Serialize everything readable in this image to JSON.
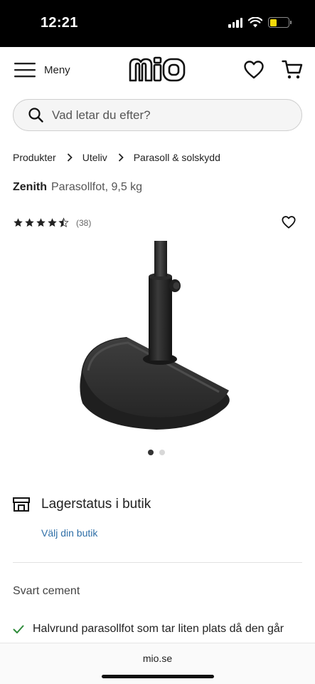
{
  "status_bar": {
    "time": "12:21"
  },
  "header": {
    "menu_label": "Meny",
    "logo_text": "mio"
  },
  "search": {
    "placeholder": "Vad letar du efter?"
  },
  "breadcrumb": [
    "Produkter",
    "Uteliv",
    "Parasoll & solskydd"
  ],
  "product": {
    "brand": "Zenith",
    "subtitle": "Parasollfot, 9,5 kg",
    "rating": 4.5,
    "review_count": "(38)",
    "image_count": 2,
    "active_image": 1
  },
  "stock": {
    "title": "Lagerstatus i butik",
    "link": "Välj din butik"
  },
  "color": "Svart cement",
  "feature": "Halvrund parasollfot som tar liten plats då den går",
  "browser": {
    "domain": "mio.se"
  },
  "colors": {
    "link": "#2f6fa7",
    "check": "#2e8b3a",
    "battery": "#f5d90a"
  }
}
